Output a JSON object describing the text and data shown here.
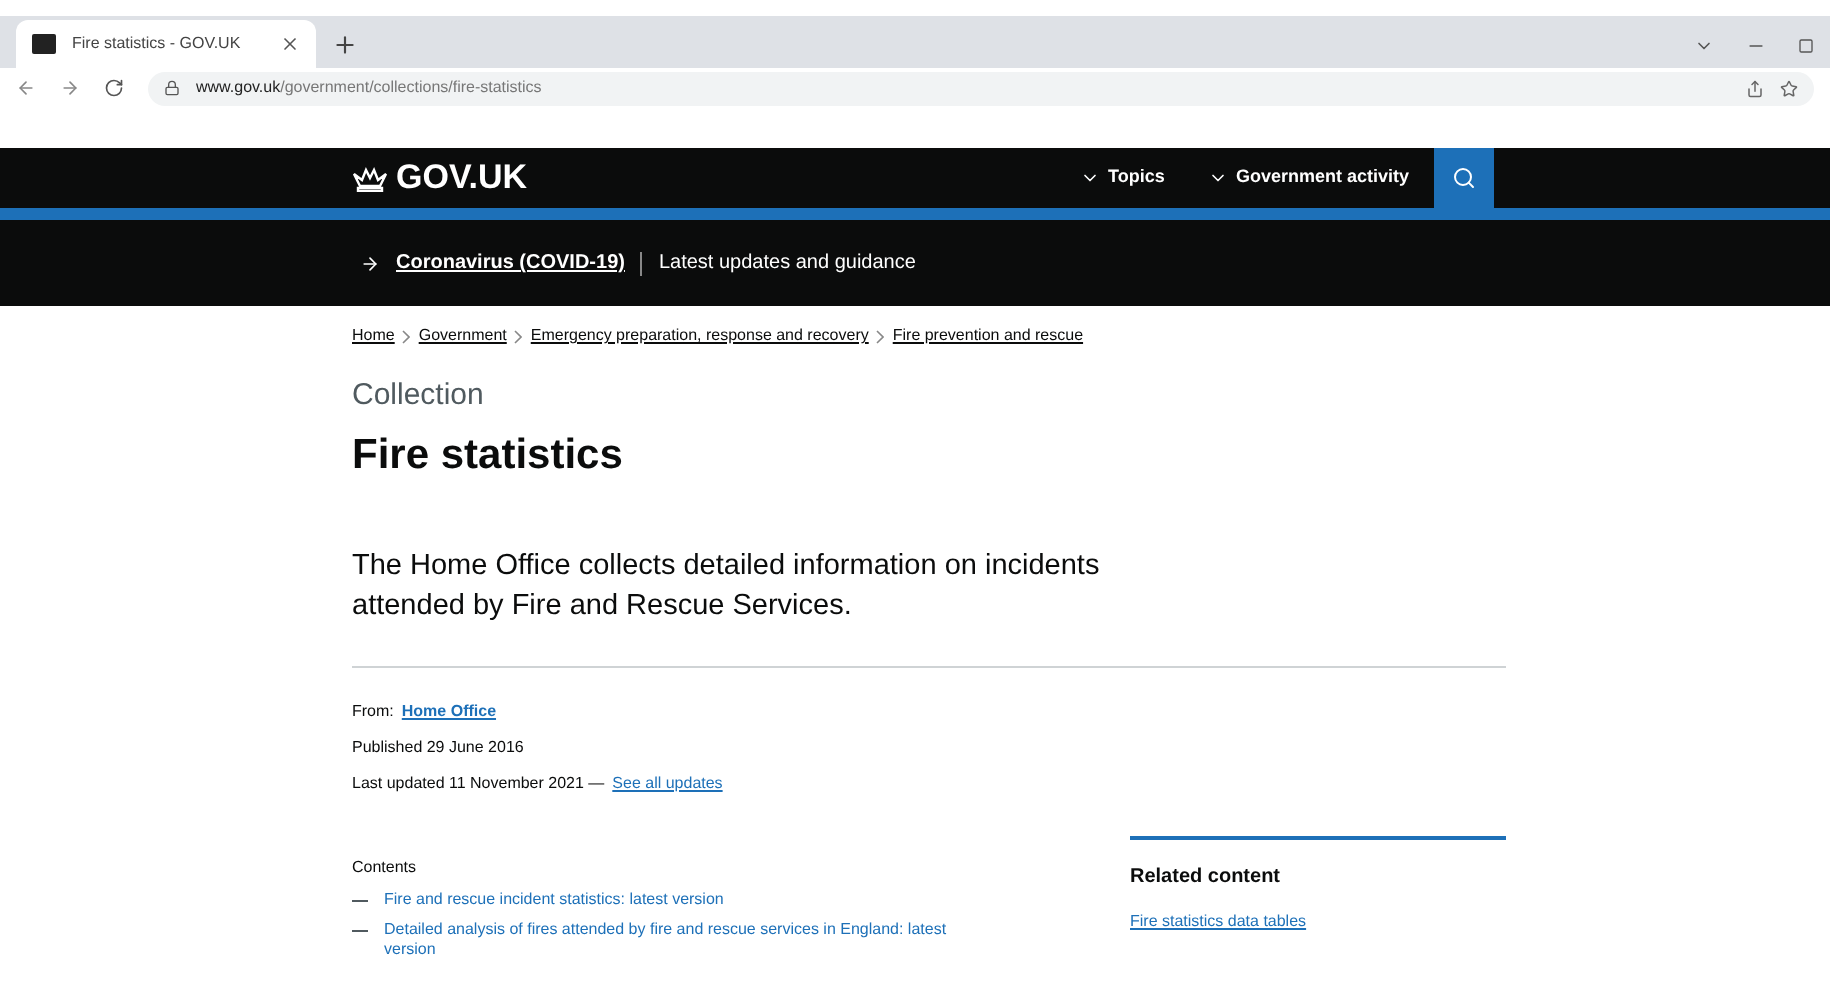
{
  "browser": {
    "tab": {
      "title": "Fire statistics - GOV.UK",
      "selected": true
    },
    "url_host": "www.gov.uk",
    "url_path": "/government/collections/fire-statistics"
  },
  "header": {
    "logo": "GOV.UK",
    "nav": [
      "Topics",
      "Government activity"
    ]
  },
  "banner": {
    "link": "Coronavirus (COVID-19)",
    "text": "Latest updates and guidance"
  },
  "breadcrumbs": [
    "Home",
    "Government",
    "Emergency preparation, response and recovery",
    "Fire prevention and rescue"
  ],
  "caption": "Collection",
  "title": "Fire statistics",
  "description": "The Home Office collects detailed information on incidents attended by Fire and Rescue Services.",
  "meta": {
    "from_label": "From:",
    "from_link": "Home Office",
    "published": "Published 29 June 2016",
    "updated": "Last updated 11 November 2021 —",
    "updates_link": "See all updates"
  },
  "contents": {
    "heading": "Contents",
    "items": [
      "Fire and rescue incident statistics: latest version",
      "Detailed analysis of fires attended by fire and rescue services in England: latest version"
    ]
  },
  "related": {
    "heading": "Related content",
    "links": [
      "Fire statistics data tables"
    ]
  }
}
